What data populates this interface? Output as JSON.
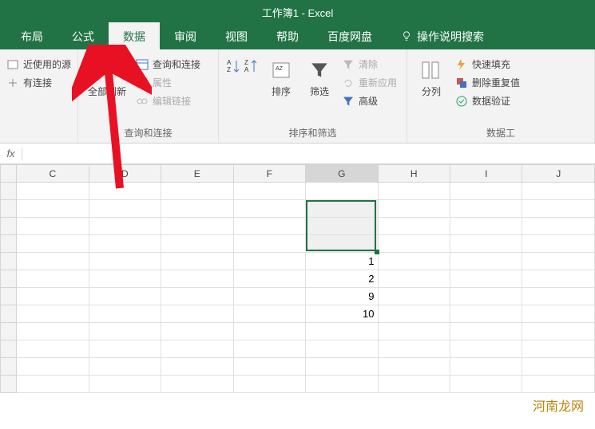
{
  "title": "工作簿1 - Excel",
  "tabs": {
    "layout": "布局",
    "formula": "公式",
    "data": "数据",
    "review": "审阅",
    "view": "视图",
    "help": "帮助",
    "baidu": "百度网盘",
    "search": "操作说明搜索"
  },
  "ribbon": {
    "recent_sources": "近使用的源",
    "existing_conn": "有连接",
    "refresh_all": "全部刷新",
    "queries_conns": "查询和连接",
    "properties": "属性",
    "edit_links": "编辑链接",
    "group_query": "查询和连接",
    "sort": "排序",
    "filter": "筛选",
    "clear": "清除",
    "reapply": "重新应用",
    "advanced": "高级",
    "group_sortfilter": "排序和筛选",
    "text_to_cols": "分列",
    "flash_fill": "快速填充",
    "remove_dup": "删除重复值",
    "data_validation": "数据验证",
    "group_datatools": "数据工"
  },
  "formula_bar": {
    "fx": "fx",
    "value": ""
  },
  "columns": [
    "C",
    "D",
    "E",
    "F",
    "G",
    "H",
    "I",
    "J"
  ],
  "selected_col": "G",
  "cells": {
    "G5": "1",
    "G6": "2",
    "G7": "9",
    "G8": "10"
  },
  "watermark": "河南龙网"
}
